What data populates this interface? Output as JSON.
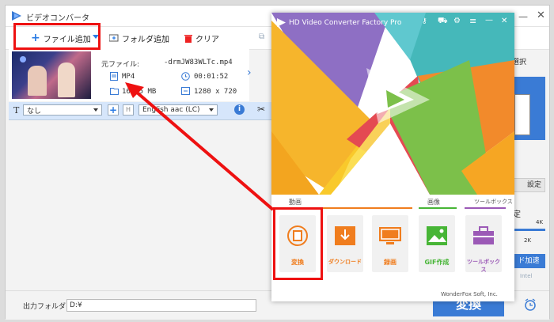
{
  "main": {
    "title": "ビデオコンバータ",
    "toolbar": {
      "add_file": "ファイル追加",
      "add_folder": "フォルダ追加",
      "clear": "クリア"
    },
    "file": {
      "source_label": "元ファイル:",
      "source_name": "-drmJW83WLTc.mp4",
      "format": "MP4",
      "duration": "00:01:52",
      "size": "16.85 MB",
      "resolution": "1280 x 720"
    },
    "controls": {
      "subtitle": "なし",
      "audio": "English aac (LC)"
    },
    "right_panel": {
      "select": "選択",
      "settings": "設定",
      "quality_prefix": "定",
      "res_4k": "4K",
      "res_2k": "2K",
      "accel": "ド加速",
      "intel": "Intel"
    },
    "output": {
      "label": "出力フォルダ:",
      "path": "D:¥",
      "convert": "変換"
    }
  },
  "popup": {
    "title": "HD Video Converter Factory Pro",
    "sections": {
      "video": "動画",
      "image": "画像",
      "toolbox": "ツールボックス"
    },
    "features": [
      {
        "label": "変換",
        "color": "#f07d1e"
      },
      {
        "label": "ダウンロード",
        "color": "#f07d1e"
      },
      {
        "label": "録画",
        "color": "#f07d1e"
      },
      {
        "label": "GIF作成",
        "color": "#47b536"
      },
      {
        "label": "ツールボックス",
        "color": "#9b59b6"
      }
    ],
    "footer": "WonderFox Soft, Inc."
  },
  "colors": {
    "accent_blue": "#3a7bd5",
    "highlight_red": "#e11111",
    "video_orange": "#f07d1e",
    "image_green": "#47b536",
    "toolbox_purple": "#9b59b6"
  }
}
